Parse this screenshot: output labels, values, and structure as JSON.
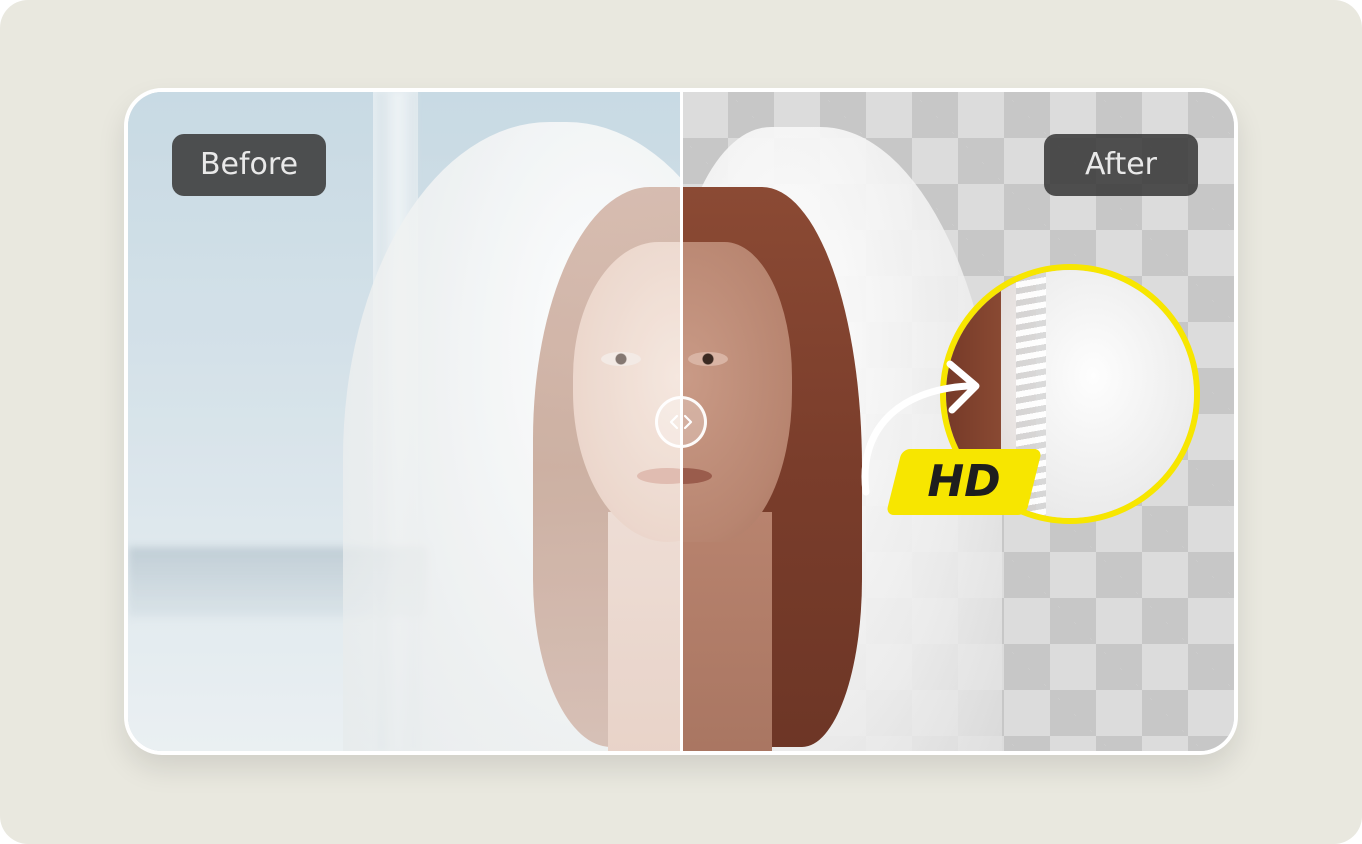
{
  "comparison": {
    "before_label": "Before",
    "after_label": "After",
    "badge_text": "HD",
    "divider_position_pct": 50
  },
  "colors": {
    "page_background": "#e9e8df",
    "label_background": "#3a3a3a",
    "accent_yellow": "#f7e600"
  },
  "icons": {
    "handle": "chevrons-left-right-icon",
    "arrow": "curved-arrow-icon"
  }
}
